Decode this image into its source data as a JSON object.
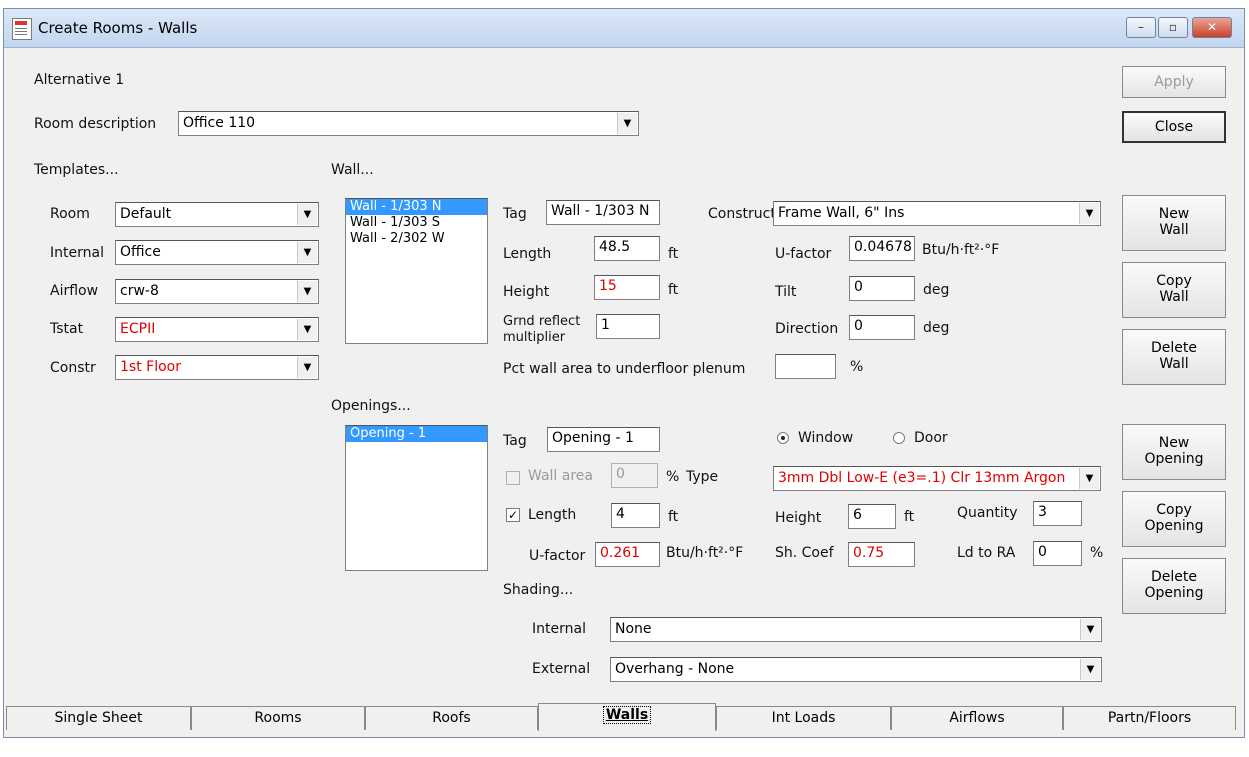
{
  "window": {
    "title": "Create Rooms - Walls",
    "min_label": "–",
    "max_label": "▫",
    "close_label": "✕"
  },
  "alternative": "Alternative 1",
  "room_description": {
    "label": "Room description",
    "value": "Office 110"
  },
  "buttons": {
    "apply": "Apply",
    "close": "Close",
    "new_wall": [
      "New",
      "Wall"
    ],
    "copy_wall": [
      "Copy",
      "Wall"
    ],
    "delete_wall": [
      "Delete",
      "Wall"
    ],
    "new_opening": [
      "New",
      "Opening"
    ],
    "copy_opening": [
      "Copy",
      "Opening"
    ],
    "delete_opening": [
      "Delete",
      "Opening"
    ]
  },
  "templates": {
    "heading": "Templates...",
    "room": {
      "label": "Room",
      "value": "Default"
    },
    "internal": {
      "label": "Internal",
      "value": "Office"
    },
    "airflow": {
      "label": "Airflow",
      "value": "crw-8"
    },
    "tstat": {
      "label": "Tstat",
      "value": "ECPII"
    },
    "constr": {
      "label": "Constr",
      "value": "1st Floor"
    }
  },
  "wall": {
    "heading": "Wall...",
    "list": [
      "Wall - 1/303 N",
      "Wall - 1/303 S",
      "Wall - 2/302 W"
    ],
    "tag": {
      "label": "Tag",
      "value": "Wall - 1/303 N"
    },
    "length": {
      "label": "Length",
      "value": "48.5",
      "unit": "ft"
    },
    "height": {
      "label": "Height",
      "value": "15",
      "unit": "ft"
    },
    "grnd_reflect": {
      "label1": "Grnd reflect",
      "label2": "multiplier",
      "value": "1"
    },
    "construct": {
      "label": "Construct",
      "value": "Frame Wall, 6\" Ins"
    },
    "u_factor": {
      "label": "U-factor",
      "value": "0.04678",
      "unit": "Btu/h·ft²·°F"
    },
    "tilt": {
      "label": "Tilt",
      "value": "0",
      "unit": "deg"
    },
    "direction": {
      "label": "Direction",
      "value": "0",
      "unit": "deg"
    },
    "plenum": {
      "label": "Pct wall area to underfloor plenum",
      "value": "",
      "unit": "%"
    }
  },
  "openings": {
    "heading": "Openings...",
    "list": [
      "Opening - 1"
    ],
    "tag": {
      "label": "Tag",
      "value": "Opening - 1"
    },
    "window_label": "Window",
    "door_label": "Door",
    "wall_area": {
      "label": "Wall area",
      "value": "0",
      "unit": "%"
    },
    "type": {
      "label": "Type",
      "value": "3mm Dbl Low-E (e3=.1) Clr 13mm Argon"
    },
    "length": {
      "label": "Length",
      "value": "4",
      "unit": "ft"
    },
    "height": {
      "label": "Height",
      "value": "6",
      "unit": "ft"
    },
    "quantity": {
      "label": "Quantity",
      "value": "3"
    },
    "u_factor": {
      "label": "U-factor",
      "value": "0.261",
      "unit": "Btu/h·ft²·°F"
    },
    "sh_coef": {
      "label": "Sh. Coef",
      "value": "0.75"
    },
    "ld_to_ra": {
      "label": "Ld to RA",
      "value": "0",
      "unit": "%"
    }
  },
  "shading": {
    "heading": "Shading...",
    "internal": {
      "label": "Internal",
      "value": "None"
    },
    "external": {
      "label": "External",
      "value": "Overhang - None"
    }
  },
  "tabs": [
    "Single Sheet",
    "Rooms",
    "Roofs",
    "Walls",
    "Int Loads",
    "Airflows",
    "Partn/Floors"
  ],
  "colors": {
    "selection": "#3399ff",
    "error_red": "#e00000"
  }
}
